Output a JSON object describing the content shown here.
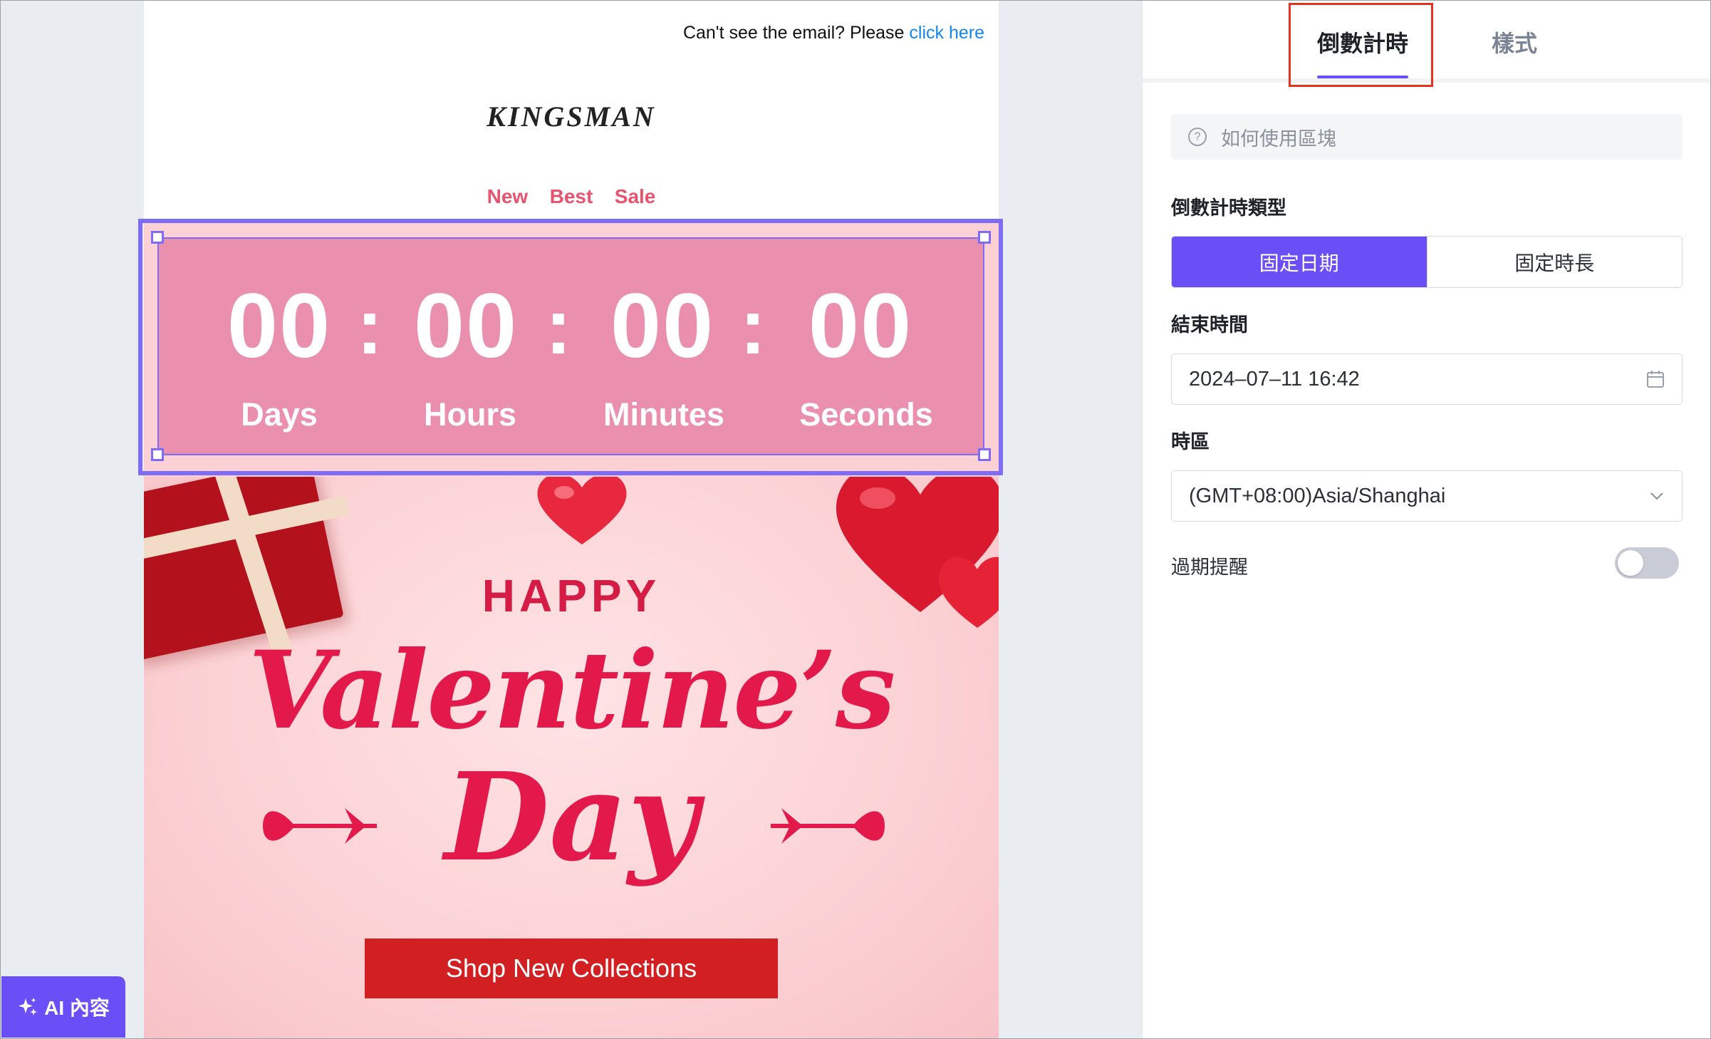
{
  "email": {
    "preheader_text": "Can't see the email? Please",
    "preheader_link": "click here",
    "brand": "KINGSMAN",
    "nav": [
      "New",
      "Best",
      "Sale"
    ],
    "countdown": {
      "days": "00",
      "hours": "00",
      "minutes": "00",
      "seconds": "00",
      "separator": ":",
      "labels": {
        "days": "Days",
        "hours": "Hours",
        "minutes": "Minutes",
        "seconds": "Seconds"
      }
    },
    "hero": {
      "happy": "HAPPY",
      "line1": "Valentine’s",
      "line2": "Day",
      "cta": "Shop New Collections"
    }
  },
  "ai_button": {
    "label": "AI 內容",
    "icon": "sparkle-icon"
  },
  "panel": {
    "tabs": [
      {
        "label": "倒數計時",
        "active": true
      },
      {
        "label": "樣式",
        "active": false
      }
    ],
    "help": "如何使用區塊",
    "type_label": "倒數計時類型",
    "type_options": [
      {
        "label": "固定日期",
        "selected": true
      },
      {
        "label": "固定時長",
        "selected": false
      }
    ],
    "end_time_label": "結束時間",
    "end_time_value": "2024–07–11 16:42",
    "timezone_label": "時區",
    "timezone_value": "(GMT+08:00)Asia/Shanghai",
    "expiry_label": "過期提醒",
    "expiry_enabled": false
  },
  "colors": {
    "accent": "#6b4ff6",
    "countdown_bg": "#ea90ae",
    "cta": "#d21f22",
    "highlight": "#e3321f"
  }
}
